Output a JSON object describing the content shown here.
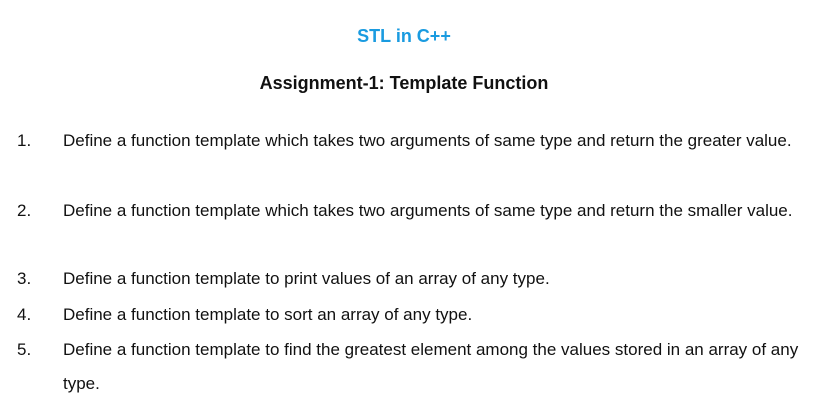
{
  "document": {
    "course_title": "STL in C++",
    "assignment_title": "Assignment-1: Template Function",
    "colors": {
      "course_title": "#1a9be0",
      "text": "#111111",
      "background": "#ffffff"
    },
    "tasks": [
      {
        "number": "1.",
        "text": "Define a function template which takes two arguments of same type and return the greater value."
      },
      {
        "number": "2.",
        "text": "Define a function template which takes two arguments of same type and return the smaller value."
      },
      {
        "number": "3.",
        "text": "Define a function template to print values of an array of any type."
      },
      {
        "number": "4.",
        "text": "Define a function template to sort an array of any type."
      },
      {
        "number": "5.",
        "text": "Define a function template to find the greatest element among the values stored in an array of any type."
      }
    ]
  }
}
